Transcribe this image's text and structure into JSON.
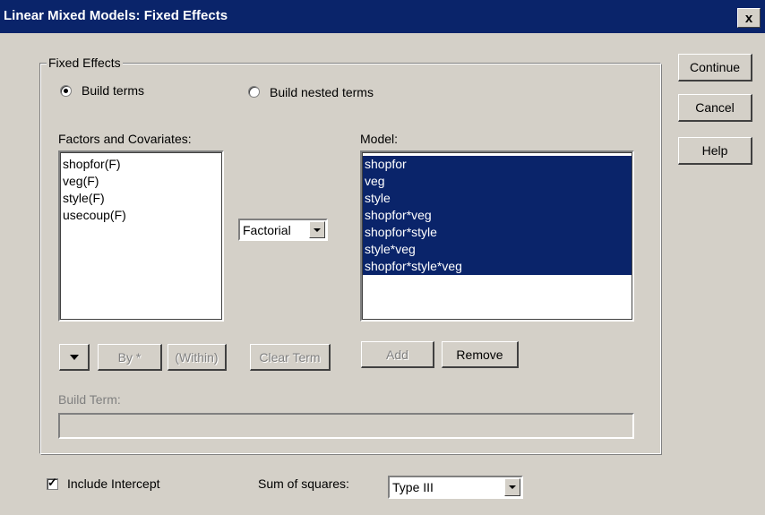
{
  "window": {
    "title": "Linear Mixed Models: Fixed Effects",
    "close_label": "x"
  },
  "group": {
    "legend": "Fixed Effects"
  },
  "radios": {
    "build_terms": {
      "label": "Build terms",
      "selected": true
    },
    "build_nested": {
      "label": "Build nested terms",
      "selected": false
    }
  },
  "factors": {
    "label": "Factors and Covariates:",
    "items": [
      "shopfor(F)",
      "veg(F)",
      "style(F)",
      "usecoup(F)"
    ]
  },
  "model": {
    "label": "Model:",
    "items": [
      "shopfor",
      "veg",
      "style",
      "shopfor*veg",
      "shopfor*style",
      "style*veg",
      "shopfor*style*veg"
    ]
  },
  "term_type": {
    "value": "Factorial"
  },
  "buttons": {
    "continue": "Continue",
    "cancel": "Cancel",
    "help": "Help",
    "by": "By *",
    "within": "(Within)",
    "clear_term": "Clear Term",
    "add": "Add",
    "remove": "Remove"
  },
  "build_term": {
    "label": "Build Term:",
    "value": ""
  },
  "intercept": {
    "label": "Include Intercept",
    "checked": true
  },
  "sum_of_squares": {
    "label": "Sum of squares:",
    "value": "Type III"
  }
}
